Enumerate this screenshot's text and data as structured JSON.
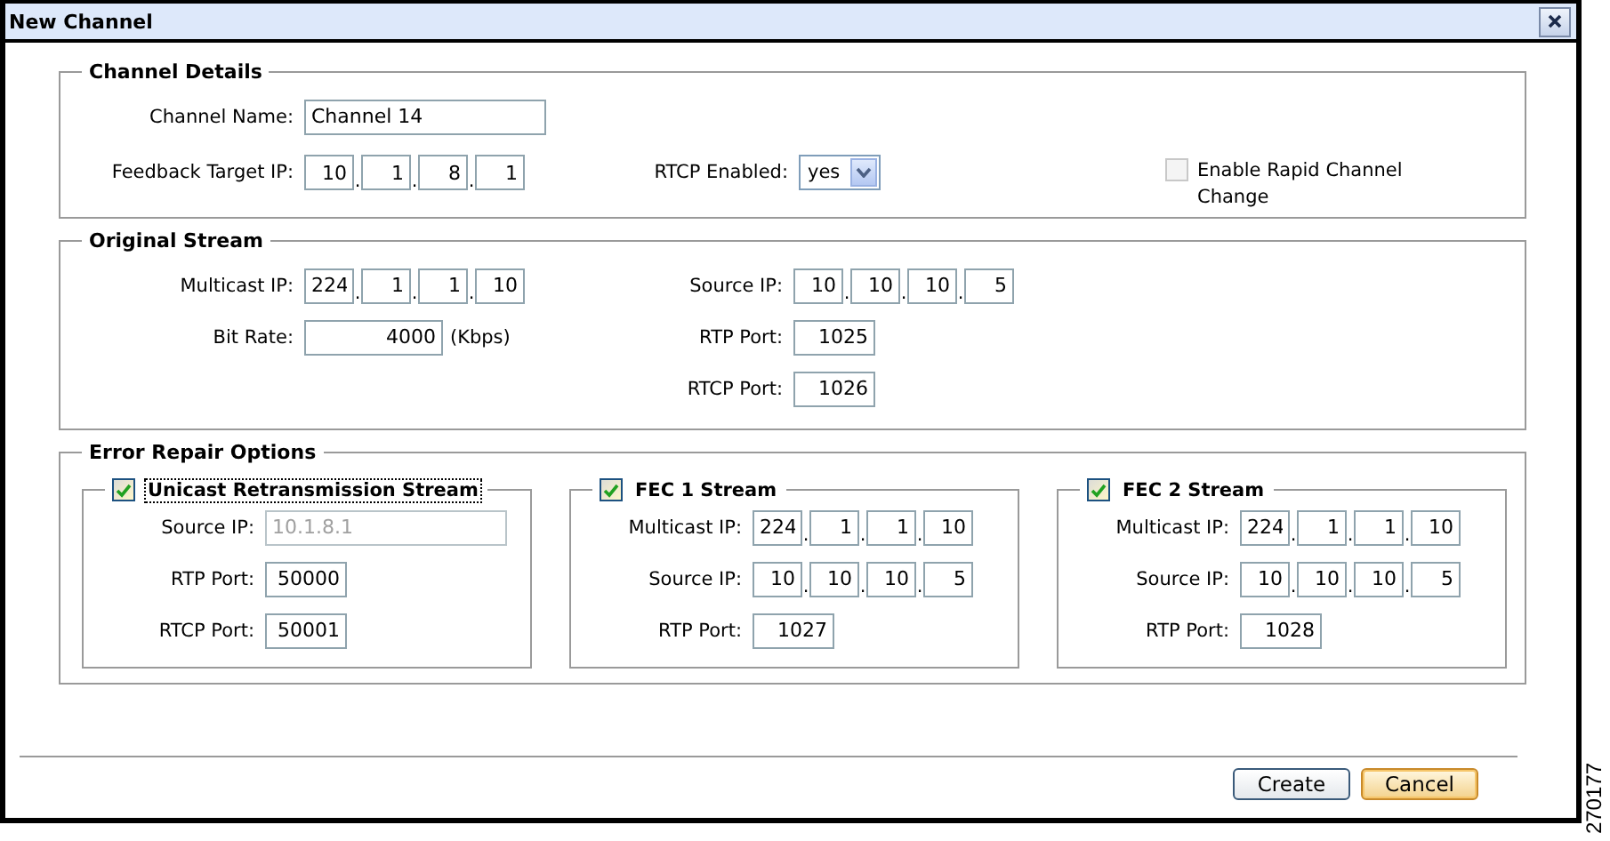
{
  "window": {
    "title": "New Channel"
  },
  "ip_separator": ".",
  "channel_details": {
    "title": "Channel Details",
    "channel_name": {
      "kind": "text",
      "label": "Channel Name:",
      "value": "Channel 14",
      "disabled": false
    },
    "feedback_target_ip": {
      "kind": "ip",
      "label": "Feedback Target IP:",
      "octets": [
        "10",
        "1",
        "8",
        "1"
      ]
    },
    "rtcp_enabled": {
      "kind": "select",
      "label": "RTCP Enabled:",
      "value": "yes"
    },
    "rapid_channel_change": {
      "label": "Enable Rapid Channel Change",
      "checked": false,
      "disabled": true
    }
  },
  "original_stream": {
    "title": "Original Stream",
    "left": [
      {
        "kind": "ip",
        "label": "Multicast IP:",
        "octets": [
          "224",
          "1",
          "1",
          "10"
        ]
      },
      {
        "kind": "rate",
        "label": "Bit Rate:",
        "value": "4000",
        "unit": "(Kbps)"
      }
    ],
    "right": [
      {
        "kind": "ip",
        "label": "Source IP:",
        "octets": [
          "10",
          "10",
          "10",
          "5"
        ]
      },
      {
        "kind": "port",
        "label": "RTP Port:",
        "value": "1025"
      },
      {
        "kind": "port",
        "label": "RTCP Port:",
        "value": "1026"
      }
    ]
  },
  "error_repair": {
    "title": "Error Repair Options",
    "streams": [
      {
        "title": "Unicast Retransmission Stream",
        "checked": true,
        "focused": true,
        "fields": [
          {
            "kind": "text",
            "label": "Source IP:",
            "value": "10.1.8.1",
            "disabled": true
          },
          {
            "kind": "port",
            "label": "RTP Port:",
            "value": "50000"
          },
          {
            "kind": "port",
            "label": "RTCP Port:",
            "value": "50001"
          }
        ]
      },
      {
        "title": "FEC 1 Stream",
        "checked": true,
        "focused": false,
        "fields": [
          {
            "kind": "ip",
            "label": "Multicast IP:",
            "octets": [
              "224",
              "1",
              "1",
              "10"
            ]
          },
          {
            "kind": "ip",
            "label": "Source IP:",
            "octets": [
              "10",
              "10",
              "10",
              "5"
            ]
          },
          {
            "kind": "port",
            "label": "RTP Port:",
            "value": "1027"
          }
        ]
      },
      {
        "title": "FEC 2 Stream",
        "checked": true,
        "focused": false,
        "fields": [
          {
            "kind": "ip",
            "label": "Multicast IP:",
            "octets": [
              "224",
              "1",
              "1",
              "10"
            ]
          },
          {
            "kind": "ip",
            "label": "Source IP:",
            "octets": [
              "10",
              "10",
              "10",
              "5"
            ]
          },
          {
            "kind": "port",
            "label": "RTP Port:",
            "value": "1028"
          }
        ]
      }
    ]
  },
  "buttons": [
    {
      "label": "Create",
      "default": false
    },
    {
      "label": "Cancel",
      "default": true
    }
  ],
  "figure_id": "270177"
}
